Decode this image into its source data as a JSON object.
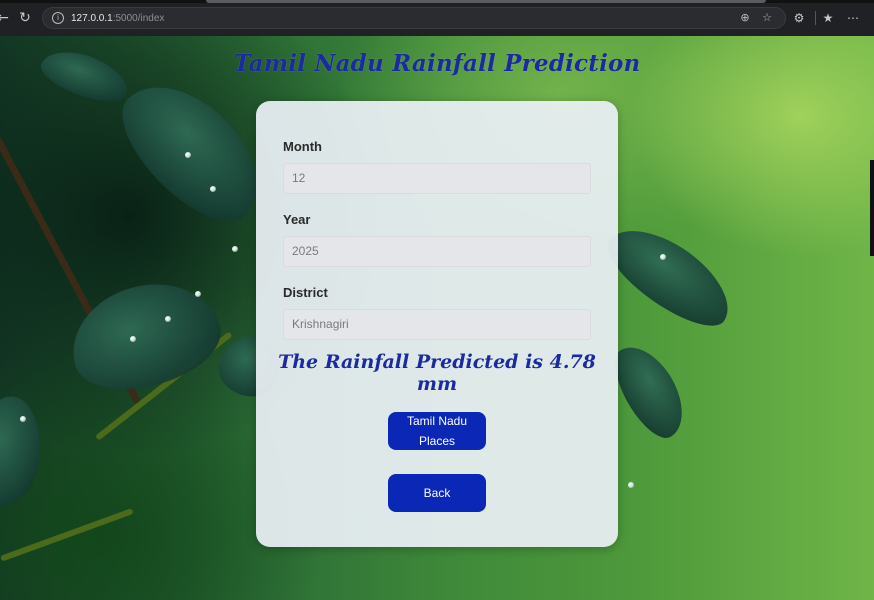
{
  "browser": {
    "url_host": "127.0.0.1",
    "url_rest": ":5000/index",
    "icons": {
      "back": "back-arrow-icon",
      "reload": "reload-icon",
      "site_info": "site-info-icon",
      "zoom": "zoom-icon",
      "bookmark": "star-icon",
      "extensions": "extensions-icon",
      "favorites": "favorites-icon",
      "menu": "more-icon"
    }
  },
  "page": {
    "title": "Tamil Nadu Rainfall Prediction",
    "form": {
      "month_label": "Month",
      "month_value": "12",
      "year_label": "Year",
      "year_value": "2025",
      "district_label": "District",
      "district_value": "Krishnagiri"
    },
    "result_text": "The Rainfall Predicted is 4.78 mm",
    "places_button": "Tamil Nadu Places",
    "back_button": "Back"
  },
  "colors": {
    "accent": "#0b27b5",
    "title": "#1a2aa0"
  }
}
